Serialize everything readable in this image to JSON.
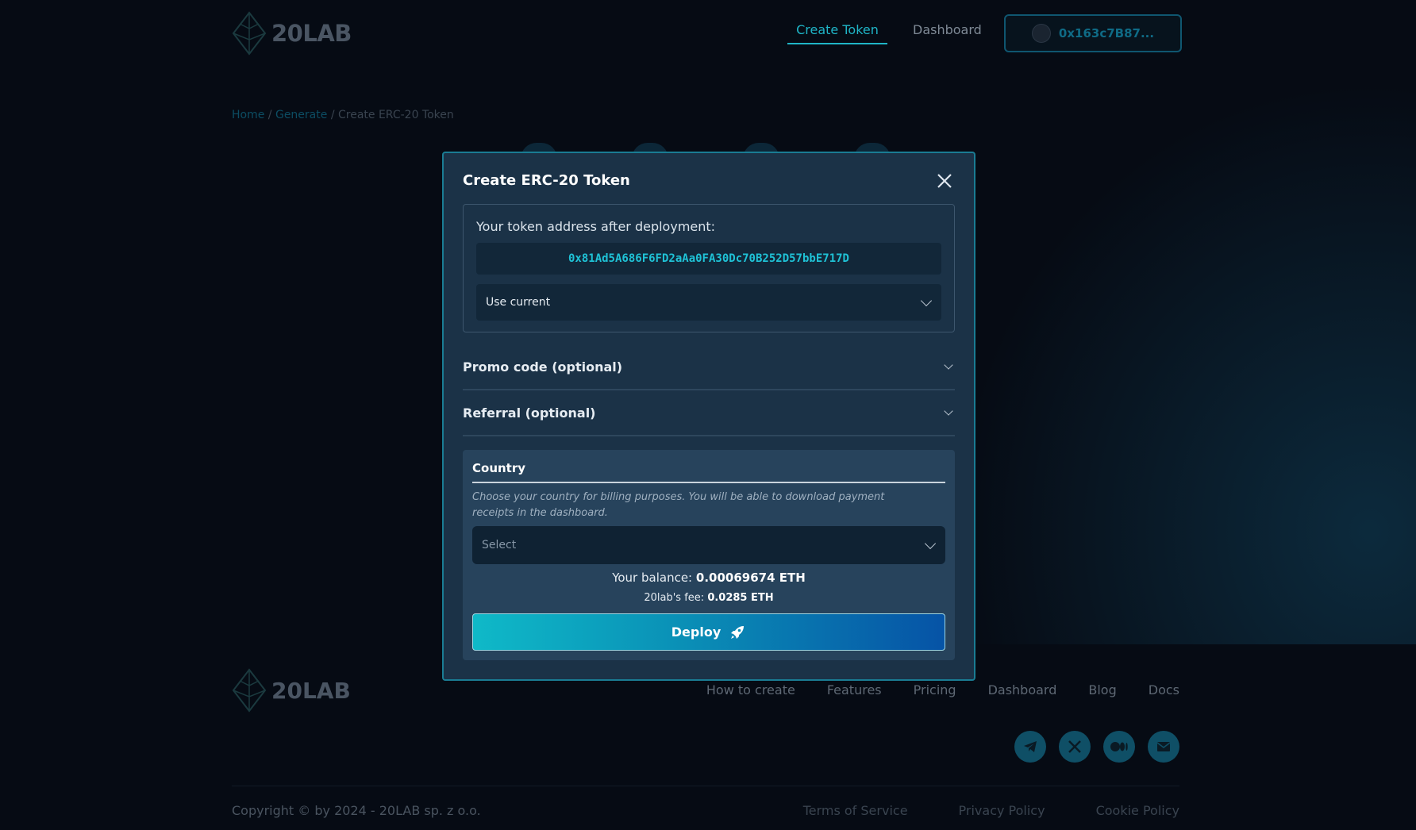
{
  "header": {
    "logo_text": "20LAB",
    "nav": {
      "create_token": "Create Token",
      "dashboard": "Dashboard"
    },
    "wallet": "0x163c7B87..."
  },
  "breadcrumb": {
    "home": "Home",
    "generate": "Generate",
    "current": "Create ERC-20 Token",
    "sep": "/"
  },
  "modal": {
    "title": "Create ERC-20 Token",
    "address_label": "Your token address after deployment:",
    "address_value": "0x81Ad5A686F6FD2aAa0FA30Dc70B252D57bbE717D",
    "address_option": "Use current",
    "promo_label": "Promo code (optional)",
    "referral_label": "Referral (optional)",
    "country": {
      "title": "Country",
      "description": "Choose your country for billing purposes. You will be able to download payment receipts in the dashboard.",
      "placeholder": "Select"
    },
    "balance_label": "Your balance:",
    "balance_value": "0.00069674 ETH",
    "fee_label": "20lab's fee:",
    "fee_value": "0.0285 ETH",
    "deploy_label": "Deploy"
  },
  "footer": {
    "logo_text": "20LAB",
    "links": [
      "How to create",
      "Features",
      "Pricing",
      "Dashboard",
      "Blog",
      "Docs"
    ],
    "socials": [
      "telegram-icon",
      "x-icon",
      "medium-icon",
      "email-icon"
    ],
    "copyright": "Copyright © by 2024 - 20LAB sp. z o.o.",
    "legal": [
      "Terms of Service",
      "Privacy Policy",
      "Cookie Policy"
    ]
  },
  "colors": {
    "accent": "#1fb5c7",
    "modal_bg": "#1b3247",
    "deploy_start": "#0fb9c8",
    "deploy_end": "#0653a6"
  }
}
